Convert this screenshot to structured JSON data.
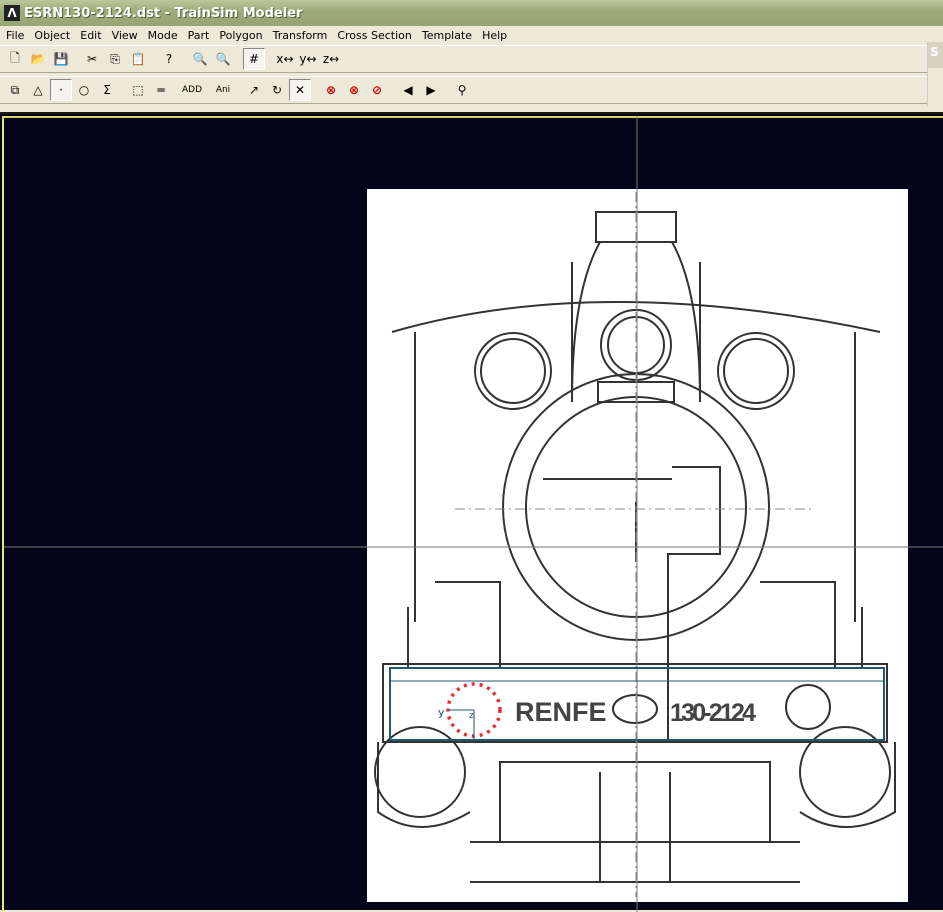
{
  "title": "ESRN130-2124.dst - TrainSim Modeler",
  "menu": [
    "File",
    "Object",
    "Edit",
    "View",
    "Mode",
    "Part",
    "Polygon",
    "Transform",
    "Cross Section",
    "Template",
    "Help"
  ],
  "side_panel_label": "S",
  "toolbar1": [
    {
      "name": "new-icon",
      "glyph": "🗋"
    },
    {
      "name": "open-icon",
      "glyph": "📂"
    },
    {
      "name": "save-icon",
      "glyph": "💾"
    },
    null,
    {
      "name": "cut-icon",
      "glyph": "✂"
    },
    {
      "name": "copy-icon",
      "glyph": "⎘"
    },
    {
      "name": "paste-icon",
      "glyph": "📋"
    },
    null,
    {
      "name": "help-icon",
      "glyph": "?"
    },
    null,
    {
      "name": "zoom-in-icon",
      "glyph": "🔍"
    },
    {
      "name": "zoom-out-icon",
      "glyph": "🔍"
    },
    null,
    {
      "name": "grid-icon",
      "glyph": "#",
      "pressed": true
    },
    null,
    {
      "name": "axis-x-icon",
      "glyph": "x↔"
    },
    {
      "name": "axis-y-icon",
      "glyph": "y↔"
    },
    {
      "name": "axis-z-icon",
      "glyph": "z↔"
    }
  ],
  "toolbar2": [
    {
      "name": "box-icon",
      "glyph": "⧉"
    },
    {
      "name": "triangle-icon",
      "glyph": "△"
    },
    {
      "name": "point-icon",
      "glyph": "·",
      "pressed": true
    },
    {
      "name": "circle-icon",
      "glyph": "○"
    },
    {
      "name": "sigma-icon",
      "glyph": "Σ"
    },
    null,
    {
      "name": "select-rect-icon",
      "glyph": "⬚"
    },
    {
      "name": "ruler-icon",
      "glyph": "═"
    },
    null,
    {
      "name": "add-icon",
      "glyph": "ADD"
    },
    null,
    {
      "name": "ani-icon",
      "glyph": "Ani"
    },
    null,
    {
      "name": "arrow-icon",
      "glyph": "↗"
    },
    {
      "name": "rotate-icon",
      "glyph": "↻"
    },
    {
      "name": "scale-icon",
      "glyph": "✕",
      "pressed": true
    },
    null,
    {
      "name": "no-x-icon",
      "glyph": "⊗",
      "red": true
    },
    {
      "name": "no-y-icon",
      "glyph": "⊗",
      "red": true
    },
    {
      "name": "no-z-icon",
      "glyph": "⊘",
      "red": true
    },
    null,
    {
      "name": "prev-icon",
      "glyph": "◀"
    },
    {
      "name": "next-icon",
      "glyph": "▶"
    },
    null,
    {
      "name": "binoculars-icon",
      "glyph": "⚲"
    }
  ],
  "drawing": {
    "left_text": "RENFE",
    "right_text": "130-2124",
    "axis_y": "y",
    "axis_z": "z"
  },
  "colors": {
    "viewport_bg": "#04041a",
    "selection": "#1f5a6e",
    "vertex": "#e03030"
  }
}
